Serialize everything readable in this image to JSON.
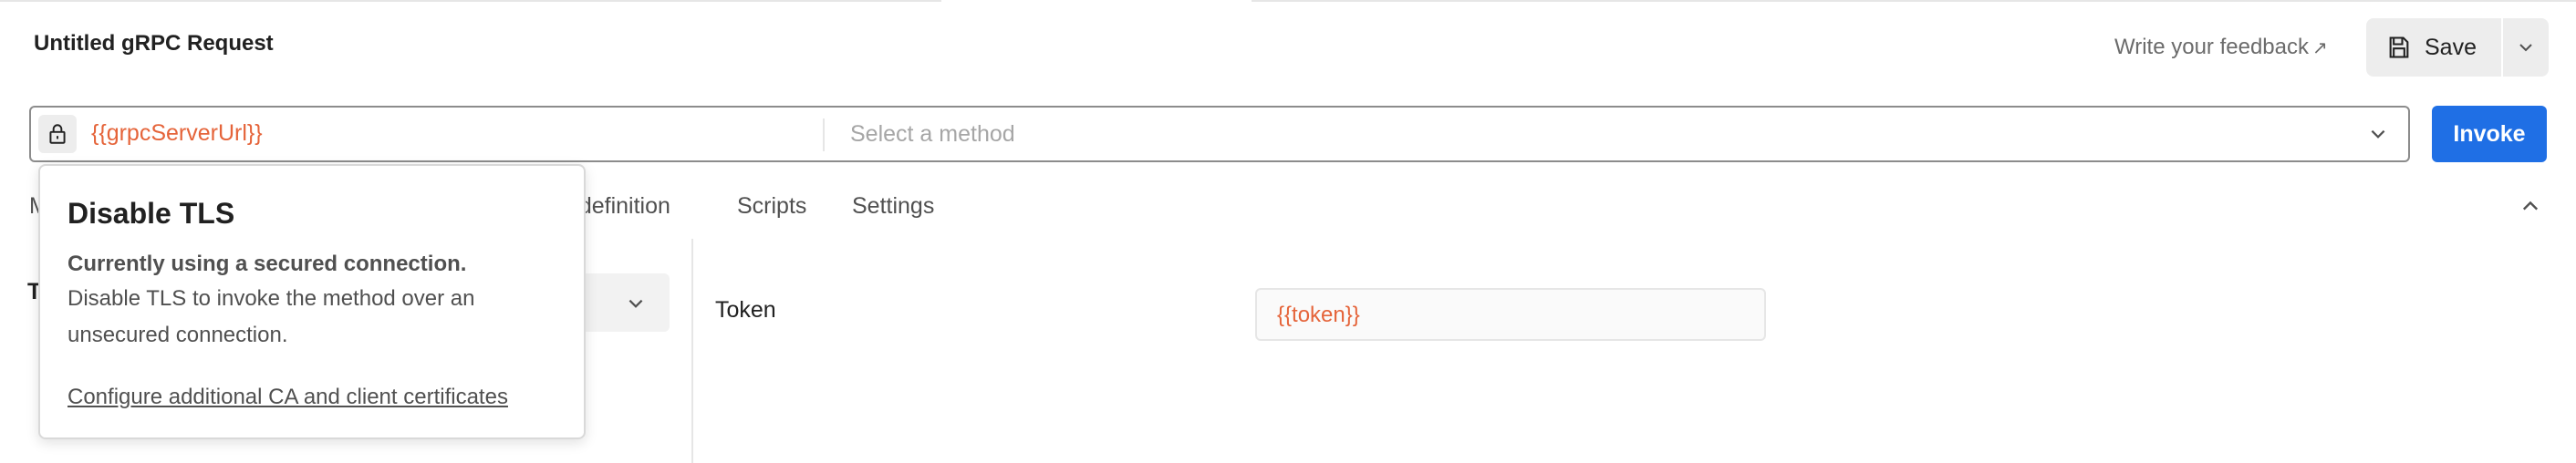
{
  "request": {
    "title": "Untitled gRPC Request"
  },
  "header": {
    "feedback_label": "Write your feedback",
    "feedback_arrow": "↗",
    "save_label": "Save"
  },
  "url_bar": {
    "server_url": "{{grpcServerUrl}}",
    "method_placeholder": "Select a method"
  },
  "invoke_label": "Invoke",
  "tabs": [
    {
      "label": "M"
    },
    {
      "label": "e definition"
    },
    {
      "label": "Scripts"
    },
    {
      "label": "Settings"
    }
  ],
  "auth": {
    "type_label_visible": "T",
    "token_label": "Token",
    "token_value": "{{token}}"
  },
  "popover": {
    "title": "Disable TLS",
    "bold_text": "Currently using a secured connection.",
    "desc_line1": "Disable TLS to invoke the method over an",
    "desc_line2": "unsecured connection.",
    "link": "Configure additional CA and client certificates"
  },
  "colors": {
    "accent": "#1f6fe5",
    "variable": "#e5643a"
  }
}
